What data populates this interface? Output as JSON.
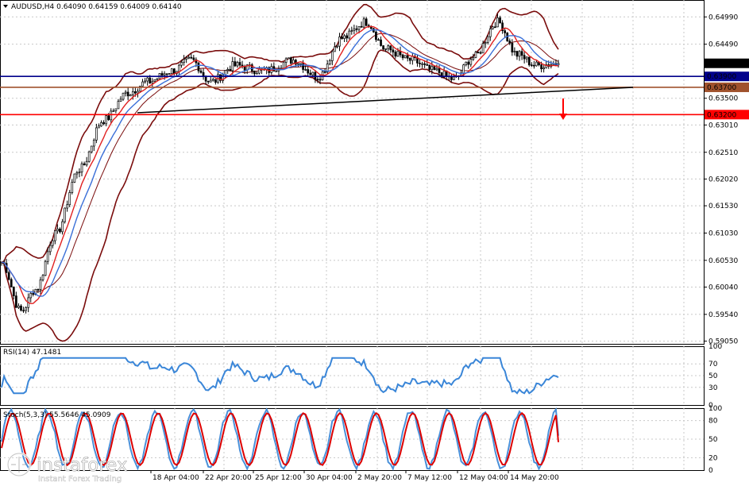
{
  "header": {
    "symbol_line": "AUDUSD,H4  0.64090 0.64159 0.64009 0.64140"
  },
  "chart_data": [
    {
      "type": "candlestick",
      "panel": "price",
      "title": "AUDUSD,H4",
      "ohlc_last": {
        "open": 0.6409,
        "high": 0.64159,
        "low": 0.64009,
        "close": 0.6414
      },
      "ylim": [
        0.59,
        0.653
      ],
      "y_ticks": [
        "0.64990",
        "0.64490",
        "0.63500",
        "0.63010",
        "0.62510",
        "0.62020",
        "0.61530",
        "0.61030",
        "0.60530",
        "0.60040",
        "0.59540",
        "0.59050"
      ],
      "x_ticks": [
        "18 Apr 04:00",
        "22 Apr 20:00",
        "25 Apr 12:00",
        "30 Apr 04:00",
        "2 May 20:00",
        "7 May 12:00",
        "12 May 04:00",
        "14 May 20:00"
      ],
      "grid": true,
      "horizontal_levels": [
        {
          "value": 0.639,
          "label": "0.63900",
          "color": "#00008b"
        },
        {
          "value": 0.637,
          "label": "0.63700",
          "color": "#a0522d"
        },
        {
          "value": 0.632,
          "label": "0.63200",
          "color": "#ff0000"
        }
      ],
      "current_price": {
        "value": 0.6414,
        "label": "0.64140"
      },
      "bollinger_bands": "shown",
      "moving_averages": [
        "red",
        "blue"
      ],
      "trendline": "rising support",
      "annotation": "red down arrow toward 0.63200"
    },
    {
      "type": "line",
      "panel": "rsi",
      "title": "RSI(14) 47.1481",
      "ylim": [
        0,
        100
      ],
      "y_ticks": [
        "100",
        "70",
        "50",
        "30",
        "0"
      ],
      "last_value": 47.1481
    },
    {
      "type": "line",
      "panel": "stochastic",
      "title": "Stoch(5,3,3) 55.5646 45.0909",
      "ylim": [
        0,
        100
      ],
      "y_ticks": [
        "100",
        "80",
        "50",
        "20",
        "0"
      ],
      "series": [
        {
          "last_value": 55.5646,
          "color": "#4a90d9"
        },
        {
          "last_value": 45.0909,
          "color": "#dd0000"
        }
      ]
    }
  ],
  "watermark": {
    "brand": "instaforex",
    "tagline": "Instant Forex Trading"
  }
}
